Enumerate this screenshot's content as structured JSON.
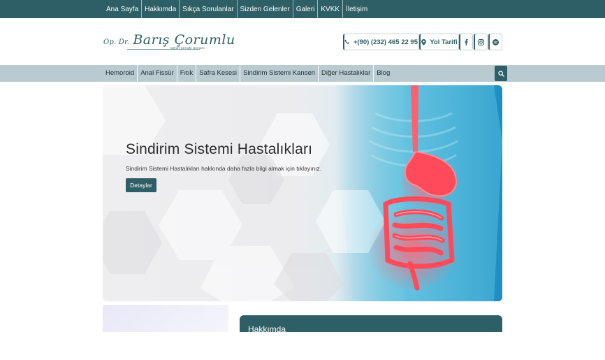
{
  "topnav": {
    "items": [
      "Ana Sayfa",
      "Hakkımda",
      "Sıkça Sorulanlar",
      "Sizden Gelenler",
      "Galeri",
      "KVKK",
      "İletişim"
    ]
  },
  "logo": {
    "prefix": "Op. Dr.",
    "name": "Barış Çorumlu",
    "subtitle": "Genel Cerrahi Uzmanı"
  },
  "contact": {
    "phone": "+(90) (232) 465 22 95",
    "directions": "Yol Tarifi",
    "icons": [
      "phone-icon",
      "map-pin-icon",
      "facebook-icon",
      "instagram-icon",
      "spotify-icon"
    ]
  },
  "catnav": {
    "items": [
      "Hemoroid",
      "Anal Fissür",
      "Fıtık",
      "Safra Kesesi",
      "Sindirim Sistemi Kanseri",
      "Diğer Hastalıklar",
      "Blog"
    ],
    "search_icon": "search-icon"
  },
  "hero": {
    "title": "Sindirim Sistemi Hastalıkları",
    "description": "Sindirim Sistemi Hastalıkları hakkında daha fazla bilgi almak için tıklayınız.",
    "button": "Detaylar"
  },
  "about": {
    "title": "Hakkımda"
  },
  "colors": {
    "primary": "#2f5f66",
    "catbar": "#b9cbd1",
    "hero_blue": "#1c8ec4",
    "organ_red": "#ff4a5a"
  }
}
